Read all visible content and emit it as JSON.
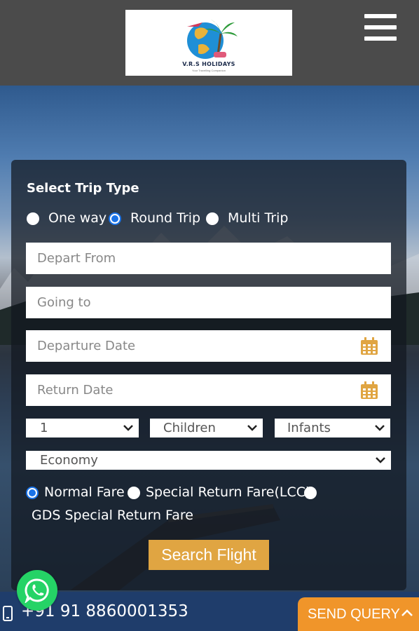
{
  "brand": {
    "name": "V.R.S HOLIDAYS",
    "tagline": "Your Travelling Companion",
    "colors": {
      "header_bg": "#4b4b4b",
      "accent": "#e0a542",
      "query": "#f0952a",
      "bottom_bar": "#1f3d6b",
      "radio": "#1a73e8"
    }
  },
  "header": {
    "menu_icon": "hamburger-menu-icon"
  },
  "search": {
    "title": "Select Trip Type",
    "trip_types": [
      {
        "label": "One way",
        "checked": false
      },
      {
        "label": "Round Trip",
        "checked": true
      },
      {
        "label": "Multi Trip",
        "checked": false
      }
    ],
    "depart_placeholder": "Depart From",
    "going_placeholder": "Going to",
    "departure_date_placeholder": "Departure Date",
    "return_date_placeholder": "Return Date",
    "adults_value": "1",
    "children_value": "Children",
    "infants_value": "Infants",
    "class_value": "Economy",
    "fare_types": [
      {
        "label": "Normal Fare",
        "checked": true
      },
      {
        "label": "Special Return Fare(LCC)",
        "checked": false
      },
      {
        "label": "GDS Special Return Fare",
        "checked": false
      }
    ],
    "search_button": "Search Flight"
  },
  "contact": {
    "phone": "+91 91 8860001353",
    "send_query": "SEND QUERY",
    "icons": [
      "phone-icon",
      "whatsapp-icon",
      "chevron-up-icon",
      "calendar-icon"
    ]
  }
}
